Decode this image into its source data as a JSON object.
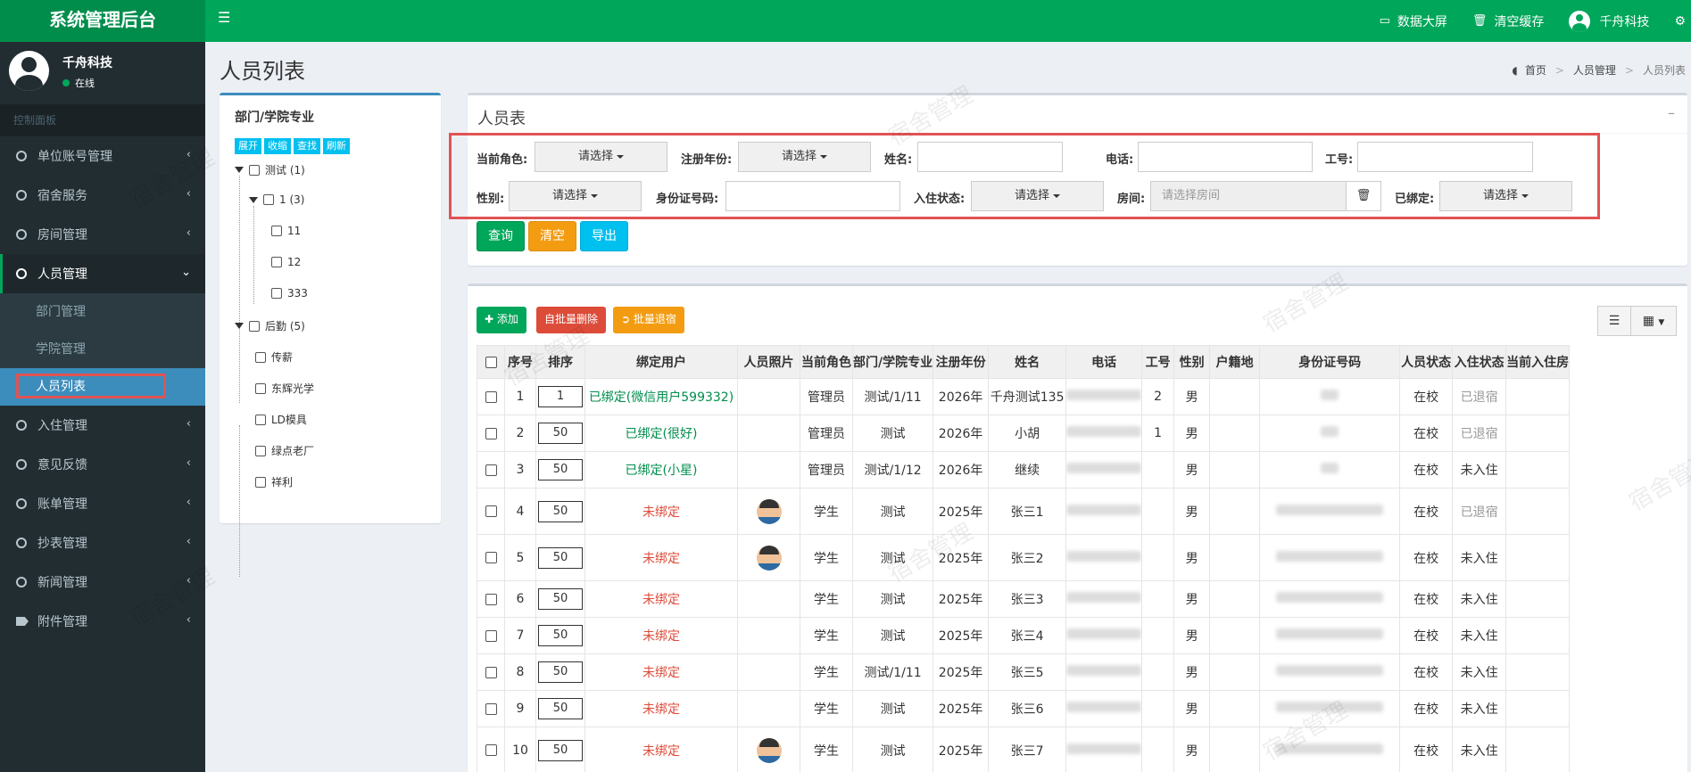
{
  "app": {
    "title": "系统管理后台",
    "header_items": [
      {
        "icon": "monitor-icon",
        "label": "数据大屏"
      },
      {
        "icon": "trash-icon",
        "label": "清空缓存"
      },
      {
        "icon": "user-avatar-icon",
        "label": "千舟科技"
      }
    ]
  },
  "user": {
    "name": "千舟科技",
    "status": "在线"
  },
  "sidebar": {
    "header": "控制面板",
    "items": [
      {
        "label": "单位账号管理"
      },
      {
        "label": "宿舍服务"
      },
      {
        "label": "房间管理"
      },
      {
        "label": "人员管理"
      },
      {
        "label": "入住管理"
      },
      {
        "label": "意见反馈"
      },
      {
        "label": "账单管理"
      },
      {
        "label": "抄表管理"
      },
      {
        "label": "新闻管理"
      },
      {
        "label": "附件管理"
      }
    ],
    "subitems": [
      "部门管理",
      "学院管理",
      "人员列表"
    ]
  },
  "page": {
    "title": "人员列表",
    "breadcrumb": [
      "首页",
      "人员管理",
      "人员列表"
    ]
  },
  "tree": {
    "title": "部门/学院专业",
    "buttons": [
      "展开",
      "收缩",
      "查找",
      "刷新"
    ],
    "nodes": [
      "测试 (1)",
      "1 (3)",
      "11",
      "12",
      "333",
      "后勤 (5)",
      "传薪",
      "东辉光学",
      "LD模具",
      "绿点老厂",
      "祥利"
    ]
  },
  "search": {
    "title": "人员表",
    "fields": {
      "role": "当前角色:",
      "year": "注册年份:",
      "name": "姓名:",
      "phone": "电话:",
      "workno": "工号:",
      "gender": "性别:",
      "idcard": "身份证号码:",
      "stay": "入住状态:",
      "room": "房间:",
      "bound": "已绑定:"
    },
    "select_placeholder": "请选择",
    "room_placeholder": "请选择房间",
    "buttons": {
      "query": "查询",
      "clear": "清空",
      "export": "导出"
    }
  },
  "list": {
    "buttons": {
      "add": "添加",
      "batch_delete": "自批量删除",
      "batch_checkout": "批量退宿"
    },
    "columns": [
      "序号",
      "排序",
      "绑定用户",
      "人员照片",
      "当前角色",
      "部门/学院专业",
      "注册年份",
      "姓名",
      "电话",
      "工号",
      "性别",
      "户籍地",
      "身份证号码",
      "人员状态",
      "入住状态",
      "当前入住房"
    ],
    "rows": [
      {
        "no": "1",
        "sort": "1",
        "bind": "已绑定(微信用户599332)",
        "bound": true,
        "photo": false,
        "role": "管理员",
        "dept": "测试/1/11",
        "year": "2026年",
        "name": "千舟测试135",
        "workno": "2",
        "gender": "男",
        "state": "在校",
        "stay": "已退宿"
      },
      {
        "no": "2",
        "sort": "50",
        "bind": "已绑定(很好)",
        "bound": true,
        "photo": false,
        "role": "管理员",
        "dept": "测试",
        "year": "2026年",
        "name": "小胡",
        "workno": "1",
        "gender": "男",
        "state": "在校",
        "stay": "已退宿"
      },
      {
        "no": "3",
        "sort": "50",
        "bind": "已绑定(小星)",
        "bound": true,
        "photo": false,
        "role": "管理员",
        "dept": "测试/1/12",
        "year": "2026年",
        "name": "继续",
        "workno": "",
        "gender": "男",
        "state": "在校",
        "stay": "未入住"
      },
      {
        "no": "4",
        "sort": "50",
        "bind": "未绑定",
        "bound": false,
        "photo": true,
        "role": "学生",
        "dept": "测试",
        "year": "2025年",
        "name": "张三1",
        "workno": "",
        "gender": "男",
        "state": "在校",
        "stay": "已退宿"
      },
      {
        "no": "5",
        "sort": "50",
        "bind": "未绑定",
        "bound": false,
        "photo": true,
        "role": "学生",
        "dept": "测试",
        "year": "2025年",
        "name": "张三2",
        "workno": "",
        "gender": "男",
        "state": "在校",
        "stay": "未入住"
      },
      {
        "no": "6",
        "sort": "50",
        "bind": "未绑定",
        "bound": false,
        "photo": false,
        "role": "学生",
        "dept": "测试",
        "year": "2025年",
        "name": "张三3",
        "workno": "",
        "gender": "男",
        "state": "在校",
        "stay": "未入住"
      },
      {
        "no": "7",
        "sort": "50",
        "bind": "未绑定",
        "bound": false,
        "photo": false,
        "role": "学生",
        "dept": "测试",
        "year": "2025年",
        "name": "张三4",
        "workno": "",
        "gender": "男",
        "state": "在校",
        "stay": "未入住"
      },
      {
        "no": "8",
        "sort": "50",
        "bind": "未绑定",
        "bound": false,
        "photo": false,
        "role": "学生",
        "dept": "测试/1/11",
        "year": "2025年",
        "name": "张三5",
        "workno": "",
        "gender": "男",
        "state": "在校",
        "stay": "未入住"
      },
      {
        "no": "9",
        "sort": "50",
        "bind": "未绑定",
        "bound": false,
        "photo": false,
        "role": "学生",
        "dept": "测试",
        "year": "2025年",
        "name": "张三6",
        "workno": "",
        "gender": "男",
        "state": "在校",
        "stay": "未入住"
      },
      {
        "no": "10",
        "sort": "50",
        "bind": "未绑定",
        "bound": false,
        "photo": true,
        "role": "学生",
        "dept": "测试",
        "year": "2025年",
        "name": "张三7",
        "workno": "",
        "gender": "男",
        "state": "在校",
        "stay": "未入住"
      }
    ]
  },
  "watermark": "宿舍管理",
  "colors": {
    "header": "#00a65a",
    "sidebar": "#222d32",
    "active_sub": "#3c8dbc",
    "highlight": "#e15353",
    "bound_text": "#008d4c",
    "unbound_text": "#dd4b39"
  }
}
